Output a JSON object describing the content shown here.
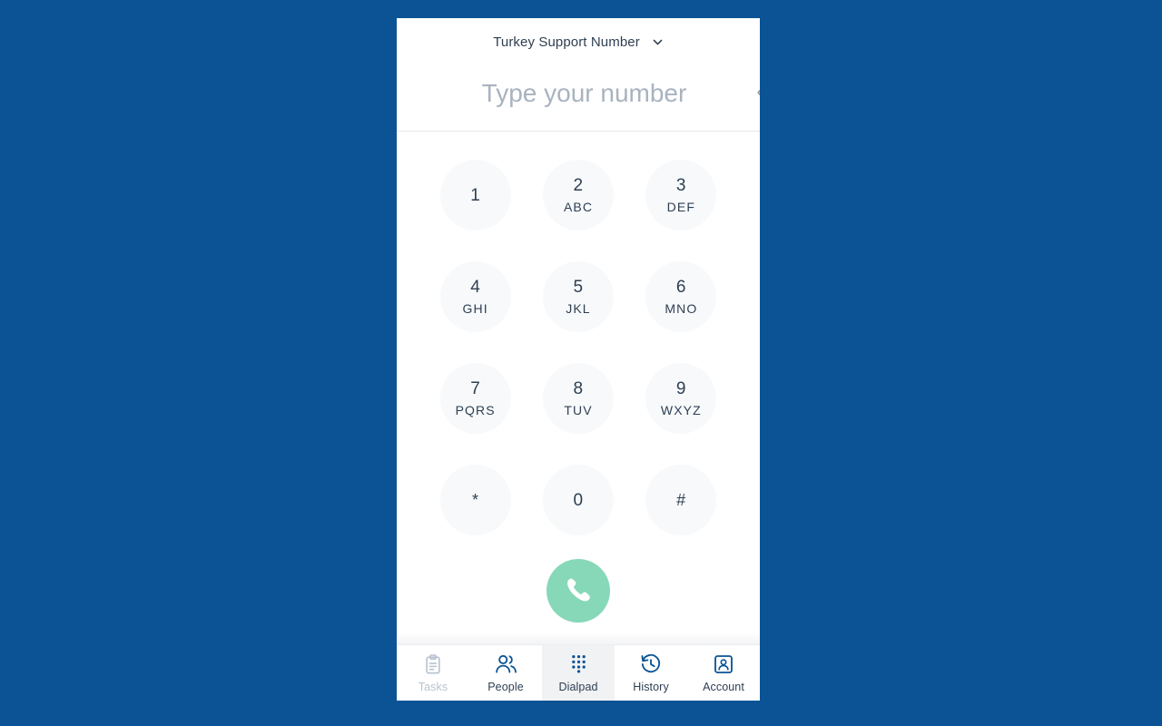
{
  "theme": {
    "page_background": "#0b5394",
    "panel_background": "#ffffff",
    "key_background": "#f7f9fb",
    "text_primary": "#2e3f52",
    "placeholder_color": "#a9b3bf",
    "call_button_green": "#86d8b8",
    "nav_icon_blue": "#0b5394",
    "nav_disabled_grey": "#b9c4d0",
    "active_tab_background": "#f1f2f4"
  },
  "header": {
    "line_selector": {
      "label": "Turkey Support Number",
      "chevron_icon": "chevron-down-icon"
    },
    "number_field": {
      "value": "",
      "placeholder": "Type your number"
    },
    "backspace": {
      "icon": "backspace-icon"
    }
  },
  "keypad": {
    "keys": [
      {
        "digit": "1",
        "letters": ""
      },
      {
        "digit": "2",
        "letters": "ABC"
      },
      {
        "digit": "3",
        "letters": "DEF"
      },
      {
        "digit": "4",
        "letters": "GHI"
      },
      {
        "digit": "5",
        "letters": "JKL"
      },
      {
        "digit": "6",
        "letters": "MNO"
      },
      {
        "digit": "7",
        "letters": "PQRS"
      },
      {
        "digit": "8",
        "letters": "TUV"
      },
      {
        "digit": "9",
        "letters": "WXYZ"
      },
      {
        "digit": "*",
        "letters": ""
      },
      {
        "digit": "0",
        "letters": ""
      },
      {
        "digit": "#",
        "letters": ""
      }
    ],
    "call_button": {
      "icon": "phone-handset-icon"
    }
  },
  "bottom_nav": {
    "items": [
      {
        "label": "Tasks",
        "icon": "clipboard-icon",
        "state": "disabled"
      },
      {
        "label": "People",
        "icon": "people-icon",
        "state": "normal"
      },
      {
        "label": "Dialpad",
        "icon": "dialpad-icon",
        "state": "active"
      },
      {
        "label": "History",
        "icon": "clock-arrow-icon",
        "state": "normal"
      },
      {
        "label": "Account",
        "icon": "account-card-icon",
        "state": "normal"
      }
    ]
  }
}
